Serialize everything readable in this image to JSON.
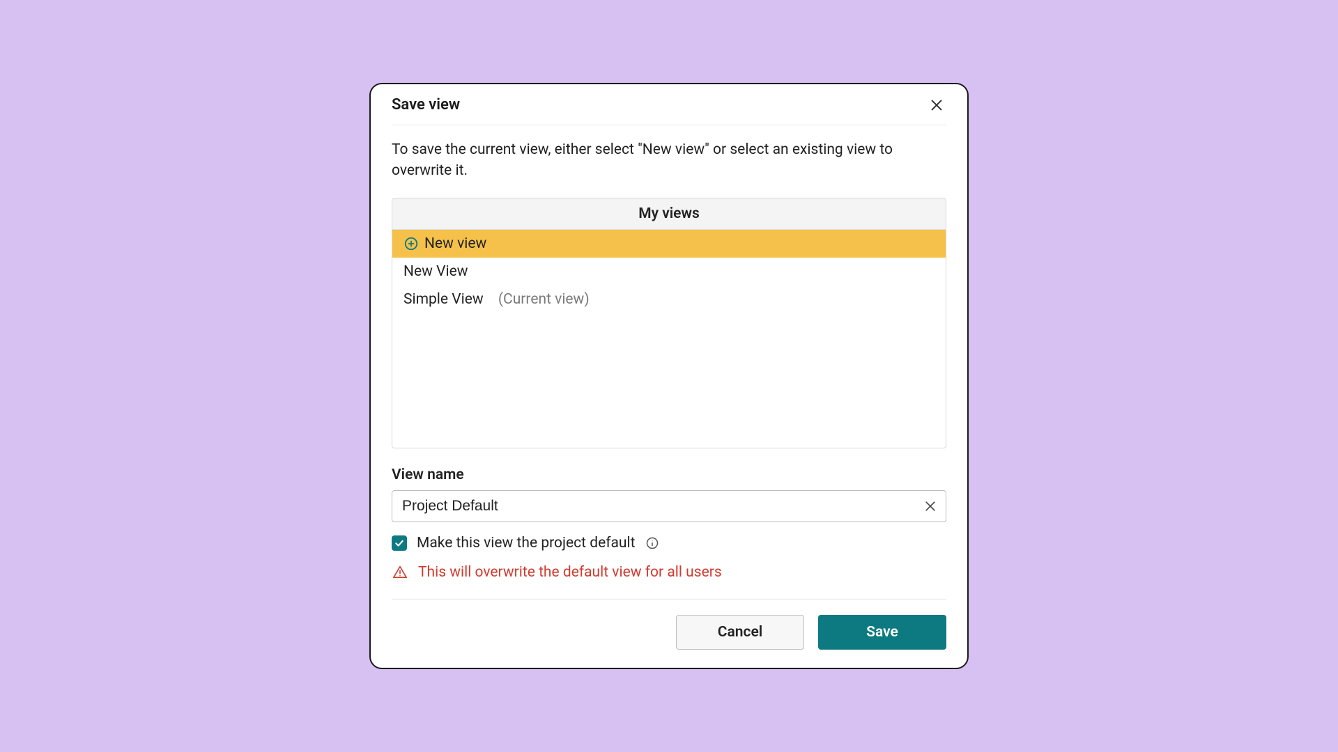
{
  "dialog": {
    "title": "Save view",
    "description": "To save the current view, either select \"New view\" or select an existing view to overwrite it.",
    "panel_header": "My views",
    "views": [
      {
        "label": "New view",
        "is_new": true,
        "selected": true
      },
      {
        "label": "New View",
        "is_new": false,
        "selected": false
      },
      {
        "label": "Simple View",
        "is_new": false,
        "selected": false,
        "suffix": "(Current view)"
      }
    ],
    "view_name_label": "View name",
    "view_name_value": "Project Default",
    "checkbox_label": "Make this view the project default",
    "checkbox_checked": true,
    "warning_text": "This will overwrite the default view for all users",
    "cancel_label": "Cancel",
    "save_label": "Save"
  }
}
